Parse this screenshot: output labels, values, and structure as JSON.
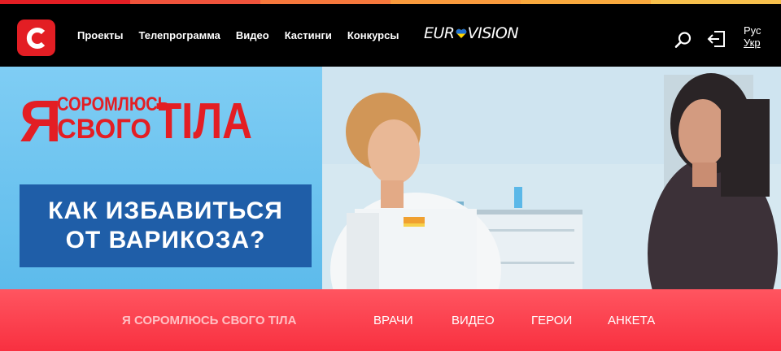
{
  "colors": {
    "stripe": [
      "#e31e24",
      "#f0533b",
      "#f7783c",
      "#f99a3c",
      "#f9a93d",
      "#f7c04c"
    ],
    "brand_red": "#e31e24",
    "headline_bg": "#1f5ea8",
    "subnav_bg": "#f83040"
  },
  "header": {
    "logo_icon": "channel-c-logo",
    "nav": [
      "Проекты",
      "Телепрограмма",
      "Видео",
      "Кастинги",
      "Конкурсы"
    ],
    "eurovision": {
      "left": "EUR",
      "right": "VISION"
    },
    "icons": {
      "search": "search-icon",
      "login": "login-icon"
    },
    "lang": {
      "ru": "Рус",
      "uk": "Укр"
    }
  },
  "hero": {
    "show_logo": {
      "line1_big": "Я",
      "line1_small": "СОРОМЛЮСЬ",
      "line2_small": "СВОГО",
      "line2_big": "ТІЛА"
    },
    "headline": {
      "line1": "КАК ИЗБАВИТЬСЯ",
      "line2": "ОТ ВАРИКОЗА?"
    }
  },
  "subnav": {
    "brand": "Я СОРОМЛЮСЬ СВОГО ТІЛА",
    "items": [
      "ВРАЧИ",
      "ВИДЕО",
      "ГЕРОИ",
      "АНКЕТА"
    ]
  }
}
